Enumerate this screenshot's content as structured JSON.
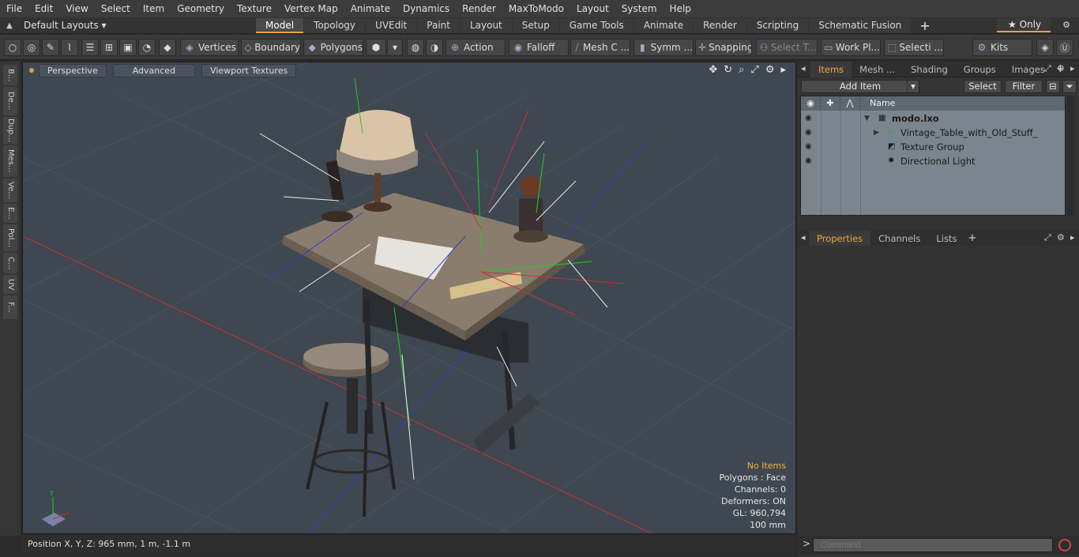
{
  "menu": [
    "File",
    "Edit",
    "View",
    "Select",
    "Item",
    "Geometry",
    "Texture",
    "Vertex Map",
    "Animate",
    "Dynamics",
    "Render",
    "MaxToModo",
    "Layout",
    "System",
    "Help"
  ],
  "layouts": {
    "label": "Default Layouts ▾"
  },
  "tabs": [
    "Model",
    "Topology",
    "UVEdit",
    "Paint",
    "Layout",
    "Setup",
    "Game Tools",
    "Animate",
    "Render",
    "Scripting",
    "Schematic Fusion"
  ],
  "active_tab": "Model",
  "only_label": "★ Only",
  "toolbar": {
    "vertices": "Vertices",
    "boundary": "Boundary",
    "polygons": "Polygons",
    "action": "Action",
    "falloff": "Falloff",
    "mesh": "Mesh C ...",
    "symm": "Symm ...",
    "snapping": "Snapping",
    "select_t": "Select T...",
    "workpl": "Work Pl...",
    "selecti": "Selecti ...",
    "kits": "Kits"
  },
  "left_strip": [
    "B...",
    "De...",
    "Dup...",
    "Mes...",
    "Ve...",
    "E...",
    "Pol...",
    "C...",
    "UV",
    "F..."
  ],
  "viewport": {
    "perspective": "Perspective",
    "advanced": "Advanced",
    "textures": "Viewport Textures",
    "stats": {
      "items": "No Items",
      "polygons": "Polygons : Face",
      "channels": "Channels: 0",
      "deformers": "Deformers: ON",
      "gl": "GL: 960,794",
      "scale": "100 mm"
    }
  },
  "status": {
    "position": "Position X, Y, Z:   965 mm, 1 m, -1.1 m"
  },
  "items_panel": {
    "tabs": [
      "Items",
      "Mesh ...",
      "Shading",
      "Groups",
      "Images"
    ],
    "active": "Items",
    "add_item": "Add Item",
    "select": "Select",
    "filter": "Filter",
    "name_header": "Name",
    "rows": [
      {
        "name": "modo.lxo",
        "icon": "scene-icon"
      },
      {
        "name": "Vintage_Table_with_Old_Stuff_",
        "icon": "mesh-group-icon"
      },
      {
        "name": "Texture Group",
        "icon": "texture-group-icon"
      },
      {
        "name": "Directional Light",
        "icon": "light-icon"
      }
    ]
  },
  "props_panel": {
    "tabs": [
      "Properties",
      "Channels",
      "Lists"
    ],
    "active": "Properties"
  },
  "command": {
    "placeholder": "Command"
  },
  "colors": {
    "accent": "#e8a33c",
    "viewport_bg": "#3f4750",
    "list_bg": "#7a858d",
    "axis_x": "#c83232",
    "axis_z": "#3a3ac8",
    "axis_y": "#22cc22"
  }
}
